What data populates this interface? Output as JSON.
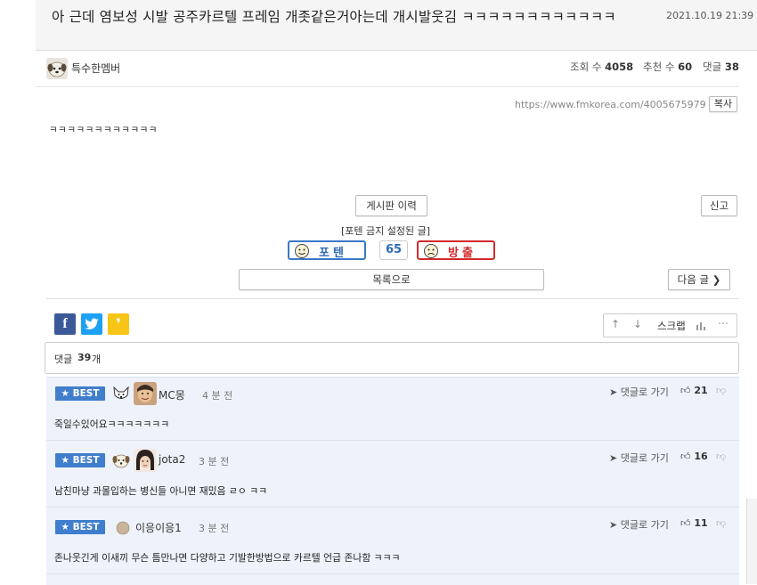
{
  "post": {
    "title": "아 근데 염보성 시발 공주카르텔 프레임 개좃같은거아는데 개시발웃김 ㅋㅋㅋㅋㅋㅋㅋㅋㅋㅋㅋㅋ",
    "date": "2021.10.19 21:39",
    "author": "특수한멤버",
    "views_label": "조회 수",
    "views": "4058",
    "recommend_label": "추천 수",
    "recommend": "60",
    "comments_label": "댓글",
    "comments": "38",
    "url": "https://www.fmkorea.com/4005675979",
    "copy_label": "복사",
    "body": "ㅋㅋㅋㅋㅋㅋㅋㅋㅋㅋㅋㅋ"
  },
  "actions": {
    "history_label": "게시판 이력",
    "report_label": "신고",
    "notice": "[포텐 금지 설정된 글]",
    "upvote_label": "포텐",
    "vote_count": "65",
    "downvote_label": "방출",
    "list_label": "목록으로",
    "next_label": "다음 글"
  },
  "toolbar": {
    "scrap_label": "스크랩"
  },
  "comment_summary": {
    "label": "댓글",
    "count": "39",
    "unit": "개"
  },
  "comments": [
    {
      "badge": "BEST",
      "nick": "MC몽",
      "time": "4 분 전",
      "text": "죽일수있어요ㅋㅋㅋㅋㅋㅋㅋ",
      "reply_label": "댓글로 가기",
      "likes": "21"
    },
    {
      "badge": "BEST",
      "nick": "jota2",
      "time": "3 분 전",
      "text": "남친마냥 과몰입하는 병신들 아니면 재밌음 ㄹㅇ ㅋㅋ",
      "reply_label": "댓글로 가기",
      "likes": "16"
    },
    {
      "badge": "BEST",
      "nick": "이응이응1",
      "time": "3 분 전",
      "text": "존나웃긴게 이새끼 무슨 틈만나면 다양하고 기발한방법으로 카르텔 언급 존나함 ㅋㅋㅋ",
      "reply_label": "댓글로 가기",
      "likes": "11"
    }
  ],
  "colors": {
    "upvote_border": "#3a78c9",
    "downvote_border": "#d42a2a",
    "best_badge": "#3f7ecc",
    "comment_bg": "#eef3fb",
    "facebook": "#3b5998",
    "twitter": "#1da1f2",
    "kakao": "#f7c516"
  },
  "icons": [
    "facebook-icon",
    "twitter-icon",
    "kakaostory-icon",
    "arrow-up-icon",
    "arrow-down-icon",
    "chart-icon",
    "more-icon",
    "send-icon",
    "thumbs-up-icon",
    "thumbs-down-icon",
    "star-icon",
    "chevron-right-icon"
  ]
}
